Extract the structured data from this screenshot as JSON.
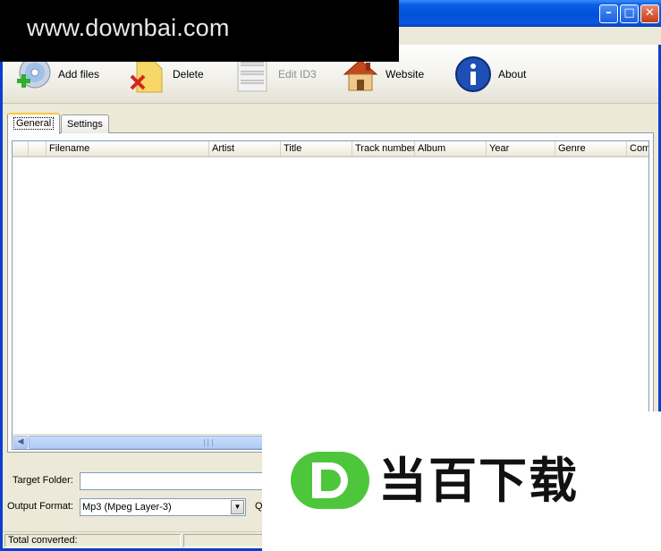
{
  "window": {
    "controls": {
      "minimize": "–",
      "maximize": "□",
      "close": "✕"
    }
  },
  "watermarks": {
    "top": "www.downbai.com",
    "bottom": "当百下载"
  },
  "toolbar": {
    "add_files": "Add files",
    "delete": "Delete",
    "edit_id3": "Edit ID3",
    "website": "Website",
    "about": "About"
  },
  "tabs": {
    "general": "General",
    "settings": "Settings"
  },
  "listview": {
    "columns": [
      "",
      "Filename",
      "Artist",
      "Title",
      "Track number",
      "Album",
      "Year",
      "Genre",
      "Com"
    ]
  },
  "form": {
    "target_folder_label": "Target Folder:",
    "target_folder_value": "",
    "output_format_label": "Output Format:",
    "output_format_value": "Mp3 (Mpeg Layer-3)",
    "quality_label_fragment": "Q"
  },
  "status": {
    "total_converted": "Total converted:"
  },
  "colors": {
    "titlebar": "#0350d8",
    "window_bg": "#ece9d8",
    "list_border": "#7f9db9",
    "logo_green": "#4ec63c"
  }
}
